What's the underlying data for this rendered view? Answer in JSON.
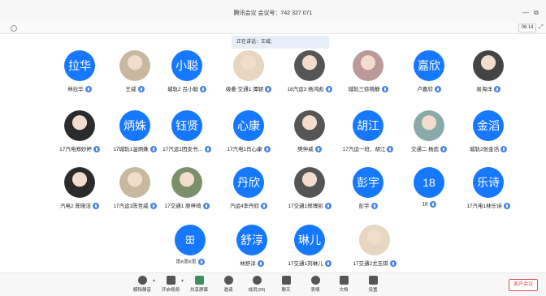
{
  "window": {
    "title": "腾讯会议  会议号：742 327 071",
    "minimize": "—",
    "restore": "⧉"
  },
  "subbar": {
    "timer": "06:14",
    "fullscreen": "⤢"
  },
  "speaking": "正在讲话：王威;",
  "participants": [
    {
      "avatar": "拉华",
      "name": "林拉华",
      "photo": false
    },
    {
      "avatar": "",
      "name": "王威",
      "photo": true
    },
    {
      "avatar": "小聪",
      "name": "城轨2 吕小聪",
      "photo": false
    },
    {
      "avatar": "",
      "name": "级委 交通1 谭颖",
      "photo": true
    },
    {
      "avatar": "",
      "name": "18汽运3 杨鸿彪",
      "photo": true
    },
    {
      "avatar": "",
      "name": "城轨三徐晓静",
      "photo": true
    },
    {
      "avatar": "嘉欣",
      "name": "卢嘉欣",
      "photo": false
    },
    {
      "avatar": "",
      "name": "易海洋",
      "photo": true
    },
    {
      "avatar": "",
      "name": "17汽电郑妙婷",
      "photo": true
    },
    {
      "avatar": "炳姝",
      "name": "17城轨1温炳姝",
      "photo": false
    },
    {
      "avatar": "钰贤",
      "name": "17汽运1团支书…",
      "photo": false
    },
    {
      "avatar": "心康",
      "name": "17汽电1肖心康",
      "photo": false
    },
    {
      "avatar": "",
      "name": "樊仲威",
      "photo": true
    },
    {
      "avatar": "胡江",
      "name": "17汽运一班、胡江",
      "photo": false
    },
    {
      "avatar": "",
      "name": "交通二 杨武",
      "photo": true
    },
    {
      "avatar": "金滔",
      "name": "城轨2张金滔",
      "photo": false
    },
    {
      "avatar": "",
      "name": "汽电2 陈晓洁",
      "photo": true
    },
    {
      "avatar": "",
      "name": "17汽运1陈世威",
      "photo": true
    },
    {
      "avatar": "",
      "name": "17交通1 廖梓琦",
      "photo": true
    },
    {
      "avatar": "丹欣",
      "name": "汽运4李丹欣",
      "photo": false
    },
    {
      "avatar": "",
      "name": "17交通1郑博凯",
      "photo": true
    },
    {
      "avatar": "彭宇",
      "name": "彭宇",
      "photo": false
    },
    {
      "avatar": "18",
      "name": "18",
      "photo": false
    },
    {
      "avatar": "乐诗",
      "name": "17汽电1林乐诗",
      "photo": false
    },
    {
      "avatar": "ꕥ",
      "name": "ꕥ೫ꕥ೫ꕥ",
      "photo": false
    },
    {
      "avatar": "舒淳",
      "name": "林舒淳",
      "photo": false
    },
    {
      "avatar": "琳儿",
      "name": "17交通1刘琳儿",
      "photo": false
    },
    {
      "avatar": "",
      "name": "17交通2尤玉琪",
      "photo": true
    }
  ],
  "toolbar": {
    "mute": "解除静音",
    "video": "开启视频",
    "share": "共享屏幕",
    "invite": "邀请",
    "members": "成员(29)",
    "chat": "聊天",
    "reactions": "表情",
    "docs": "文档",
    "settings": "设置",
    "leave": "离开会议"
  },
  "colors": {
    "accent": "#1677ff",
    "leave": "#e34d59"
  }
}
